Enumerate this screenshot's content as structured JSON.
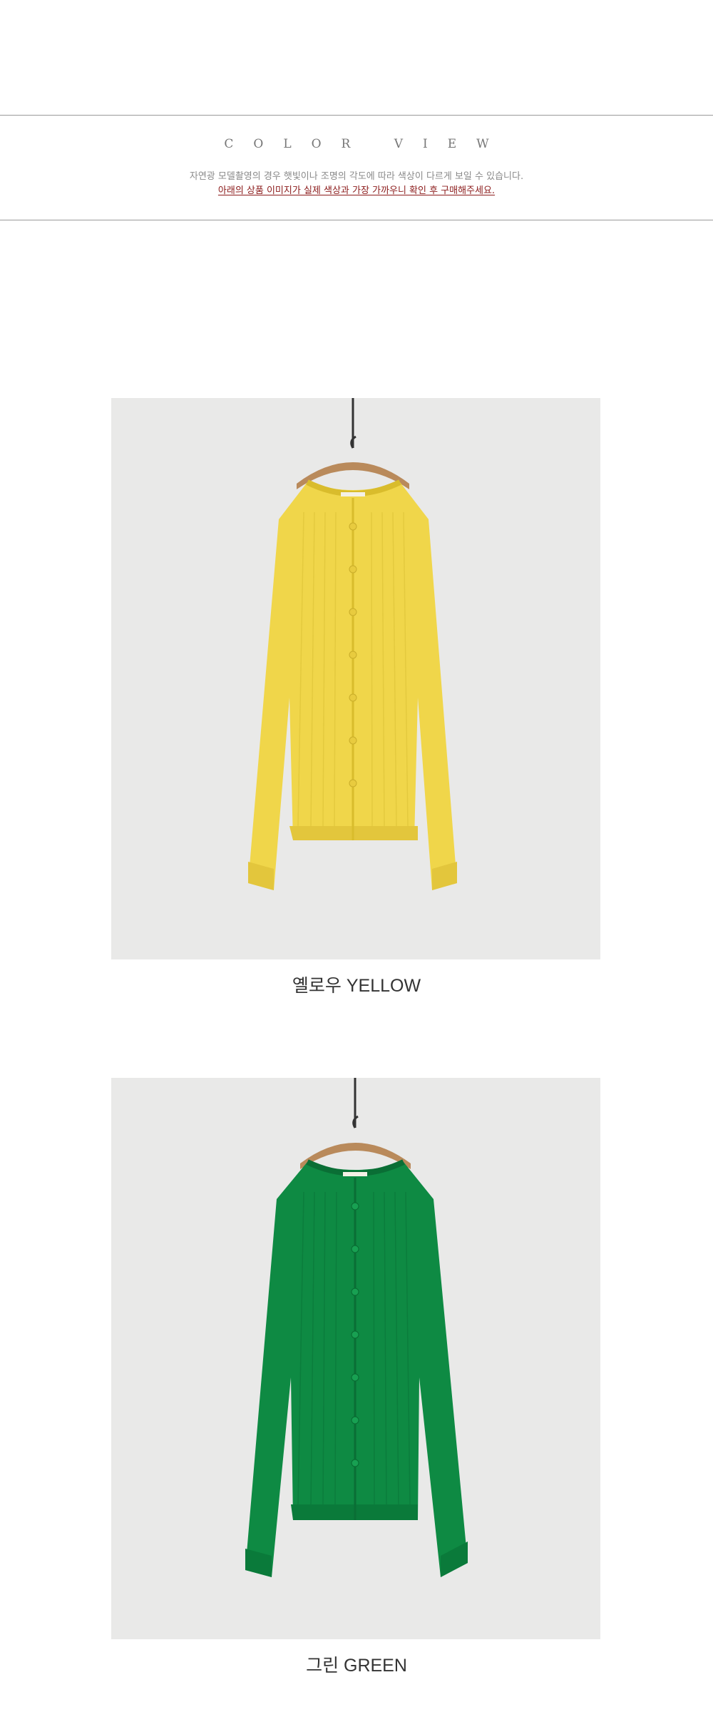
{
  "header": {
    "title": "COLOR VIEW",
    "notice_line1": "자연광 모델촬영의 경우 햇빛이나 조명의 각도에 따라 색상이 다르게 보일 수 있습니다.",
    "notice_line2": "아래의 상품 이미지가 실제 색상과 가장 가까우니 확인 후 구매해주세요."
  },
  "products": [
    {
      "label": "옐로우 YELLOW",
      "color": "#f0d64a",
      "color_shade": "#d9bc2c",
      "color_light": "#f7e36e"
    },
    {
      "label": "그린 GREEN",
      "color": "#0e8a43",
      "color_shade": "#0a6e35",
      "color_light": "#18a052"
    }
  ],
  "colors": {
    "background": "#ffffff",
    "rule": "#9a9a9a",
    "notice_red": "#8b1a1a",
    "photo_bg": "#e9e9e8"
  }
}
